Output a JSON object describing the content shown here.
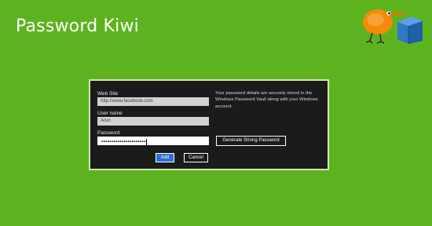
{
  "app": {
    "title": "Password Kiwi"
  },
  "form": {
    "website_label": "Web Site",
    "website_value": "http://www.facebook.com",
    "username_label": "User name",
    "username_value": "Arun",
    "password_label": "Password",
    "password_value": "••••••••••••••••••••••",
    "info_text": "Your password details are securely stored in the Windows Password Vault along with your Windows account.",
    "generate_label": "Generate Strong Password",
    "add_label": "Add",
    "cancel_label": "Cancel"
  },
  "colors": {
    "background": "#5db31f",
    "dialog": "#1b1b1b",
    "primary_button": "#2d6fd1",
    "kiwi": "#f58a07",
    "vault": "#2f78c6"
  },
  "icons": {
    "logo": "kiwi-bird-with-vault-icon"
  }
}
